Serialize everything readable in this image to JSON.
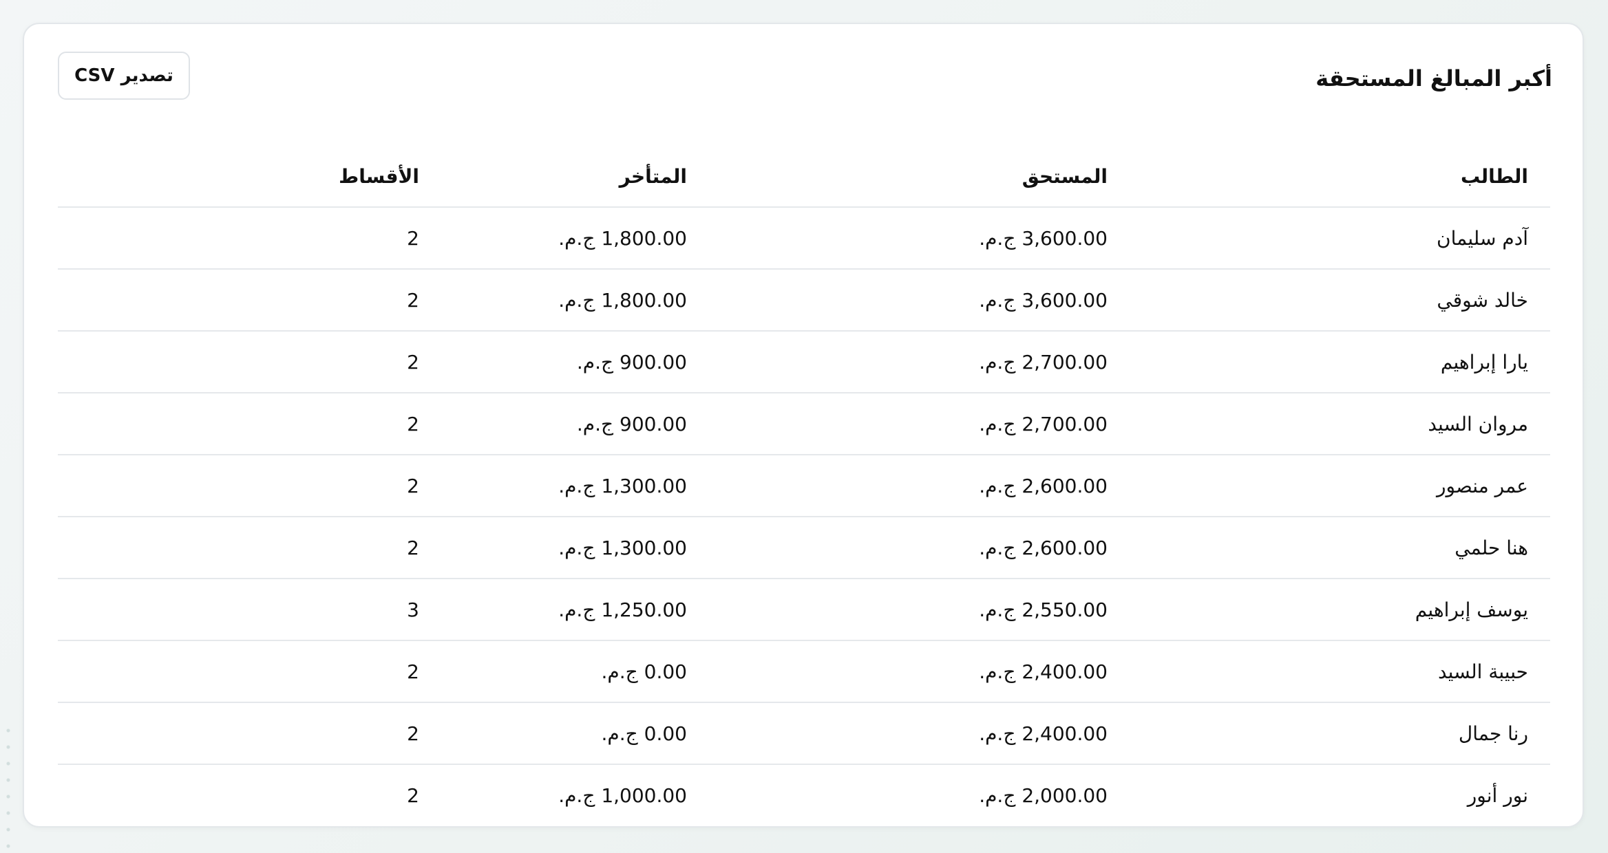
{
  "card": {
    "title": "أكبر المبالغ المستحقة",
    "export_label": "تصدير CSV"
  },
  "table": {
    "headers": {
      "student": "الطالب",
      "due": "المستحق",
      "overdue": "المتأخر",
      "installments": "الأقساط"
    },
    "rows": [
      {
        "student": "آدم سليمان",
        "due": "3,600.00 ج.م.",
        "overdue": "1,800.00 ج.م.",
        "installments": "2"
      },
      {
        "student": "خالد شوقي",
        "due": "3,600.00 ج.م.",
        "overdue": "1,800.00 ج.م.",
        "installments": "2"
      },
      {
        "student": "يارا إبراهيم",
        "due": "2,700.00 ج.م.",
        "overdue": "900.00 ج.م.",
        "installments": "2"
      },
      {
        "student": "مروان السيد",
        "due": "2,700.00 ج.م.",
        "overdue": "900.00 ج.م.",
        "installments": "2"
      },
      {
        "student": "عمر منصور",
        "due": "2,600.00 ج.م.",
        "overdue": "1,300.00 ج.م.",
        "installments": "2"
      },
      {
        "student": "هنا حلمي",
        "due": "2,600.00 ج.م.",
        "overdue": "1,300.00 ج.م.",
        "installments": "2"
      },
      {
        "student": "يوسف إبراهيم",
        "due": "2,550.00 ج.م.",
        "overdue": "1,250.00 ج.م.",
        "installments": "3"
      },
      {
        "student": "حبيبة السيد",
        "due": "2,400.00 ج.م.",
        "overdue": "0.00 ج.م.",
        "installments": "2"
      },
      {
        "student": "رنا جمال",
        "due": "2,400.00 ج.م.",
        "overdue": "0.00 ج.م.",
        "installments": "2"
      },
      {
        "student": "نور أنور",
        "due": "2,000.00 ج.م.",
        "overdue": "1,000.00 ج.م.",
        "installments": "2"
      }
    ]
  },
  "colors": {
    "card_background": "#ffffff",
    "border": "#e5e8eb",
    "text": "#111111"
  }
}
